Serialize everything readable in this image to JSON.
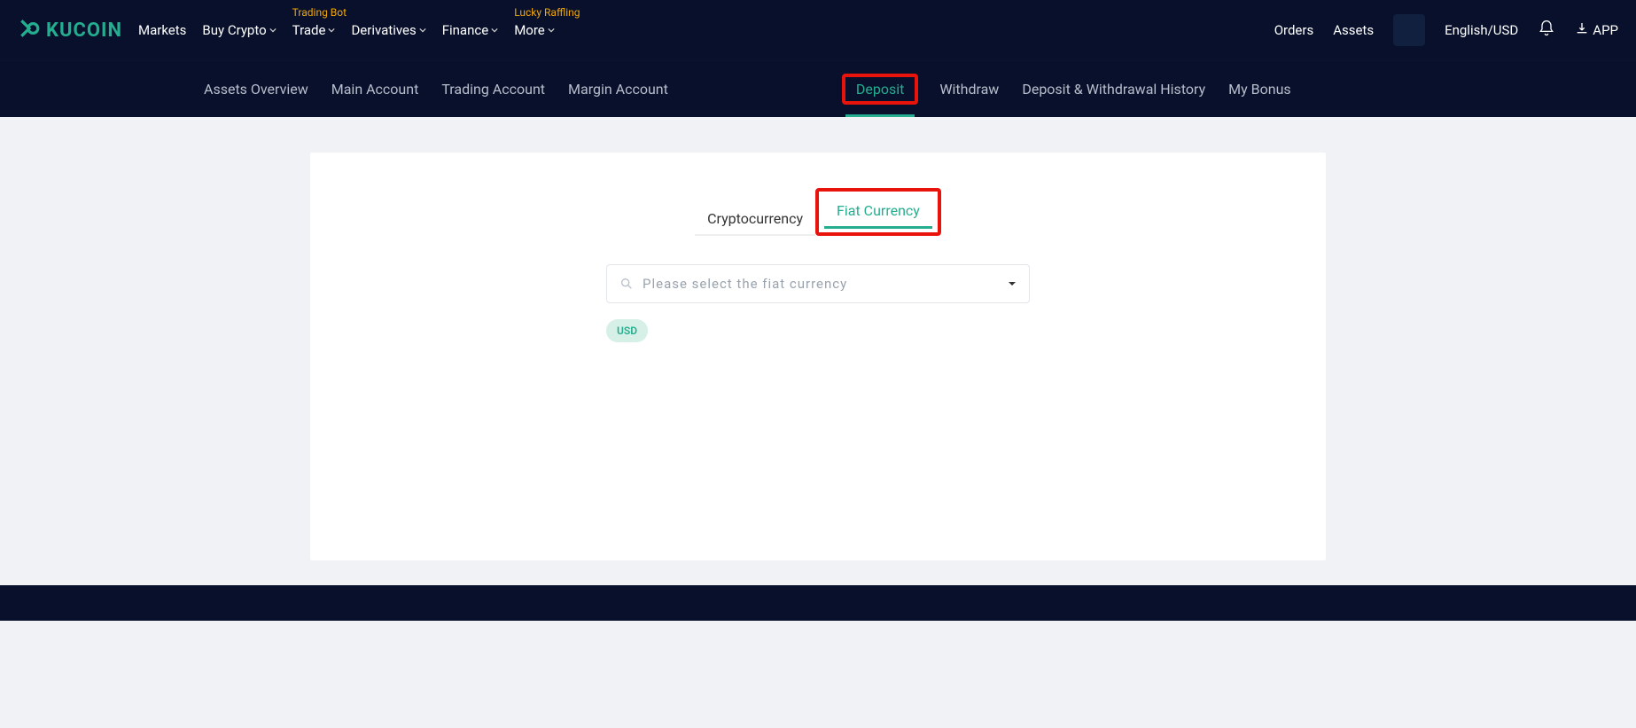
{
  "brand": {
    "name": "KUCOIN"
  },
  "topnav": {
    "items": [
      {
        "label": "Markets",
        "dropdown": false,
        "badge": null
      },
      {
        "label": "Buy Crypto",
        "dropdown": true,
        "badge": null
      },
      {
        "label": "Trade",
        "dropdown": true,
        "badge": "Trading Bot"
      },
      {
        "label": "Derivatives",
        "dropdown": true,
        "badge": null
      },
      {
        "label": "Finance",
        "dropdown": true,
        "badge": null
      },
      {
        "label": "More",
        "dropdown": true,
        "badge": "Lucky Raffling"
      }
    ],
    "right": {
      "orders": "Orders",
      "assets": "Assets",
      "lang_currency": "English/USD",
      "app": "APP"
    }
  },
  "subnav": {
    "left": [
      "Assets Overview",
      "Main Account",
      "Trading Account",
      "Margin Account"
    ],
    "right": [
      {
        "label": "Deposit",
        "active": true,
        "highlighted": true
      },
      {
        "label": "Withdraw",
        "active": false,
        "highlighted": false
      },
      {
        "label": "Deposit & Withdrawal History",
        "active": false,
        "highlighted": false
      },
      {
        "label": "My Bonus",
        "active": false,
        "highlighted": false
      }
    ]
  },
  "deposit": {
    "tabs": [
      {
        "label": "Cryptocurrency",
        "active": false,
        "highlighted": false
      },
      {
        "label": "Fiat Currency",
        "active": true,
        "highlighted": true
      }
    ],
    "select_placeholder": "Please select the fiat currency",
    "chips": [
      "USD"
    ]
  }
}
